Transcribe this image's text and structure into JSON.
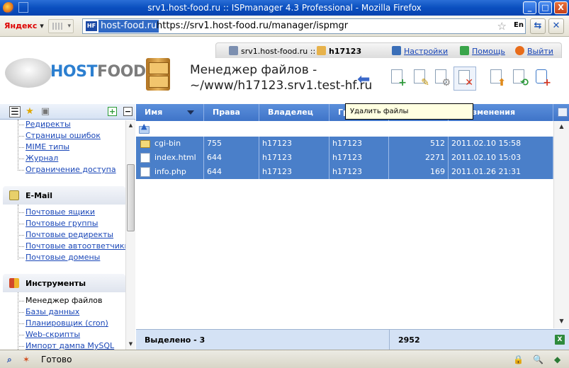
{
  "window": {
    "title": "srv1.host-food.ru :: ISPmanager 4.3 Professional - Mozilla Firefox",
    "minimize_glyph": "_",
    "maximize_glyph": "□",
    "close_glyph": "X"
  },
  "browser": {
    "search_engine": "Яндекс",
    "signal_label": "▾",
    "site_badge": "HF",
    "site_domain": "host-food.ru",
    "url": "https://srv1.host-food.ru/manager/ispmgr",
    "star_glyph": "☆",
    "lang": "En",
    "nav_glyph_1": "⇆",
    "nav_glyph_2": "✕"
  },
  "infobar": {
    "server": "srv1.host-food.ru ::",
    "user": "h17123",
    "settings": "Настройки",
    "help": "Помощь",
    "logout": "Выйти"
  },
  "logo": {
    "host": "HOST",
    "food": "FOOD"
  },
  "page": {
    "title_line1": "Менеджер файлов -",
    "title_line2": "~/www/h17123.srv1.test-hf.ru"
  },
  "tooltip": "Удалить файлы",
  "sidebar": {
    "tab_glyphs": [
      "☰",
      "★",
      "▣"
    ],
    "expand": "+",
    "collapse": "−",
    "group1": [
      "Редиректы",
      "Страницы ошибок",
      "MIME типы",
      "Журнал",
      "Ограничение доступа"
    ],
    "email_section": "E-Mail",
    "email_items": [
      "Почтовые ящики",
      "Почтовые группы",
      "Почтовые редиректы",
      "Почтовые автоответчики",
      "Почтовые домены"
    ],
    "tools_section": "Инструменты",
    "tools_items": [
      "Менеджер файлов",
      "Базы данных",
      "Планировщик (cron)",
      "Web-скрипты",
      "Импорт дампа MySQL"
    ]
  },
  "table": {
    "columns": [
      "Имя",
      "Права",
      "Владелец",
      "Гр",
      "",
      "ата изменения"
    ],
    "rows": [
      {
        "name": "cgi-bin",
        "type": "folder",
        "perms": "755",
        "owner": "h17123",
        "group": "h17123",
        "size": "512",
        "date": "2011.02.10 15:58"
      },
      {
        "name": "index.html",
        "type": "file",
        "perms": "644",
        "owner": "h17123",
        "group": "h17123",
        "size": "2271",
        "date": "2011.02.10 15:03"
      },
      {
        "name": "info.php",
        "type": "file",
        "perms": "644",
        "owner": "h17123",
        "group": "h17123",
        "size": "169",
        "date": "2011.01.26 21:31"
      }
    ],
    "footer_selected": "Выделено - 3",
    "footer_total": "2952",
    "excel_label": "X"
  },
  "status": {
    "text": "Готово",
    "lock_glyph": "🔒",
    "zoom_glyph": "🔍"
  }
}
